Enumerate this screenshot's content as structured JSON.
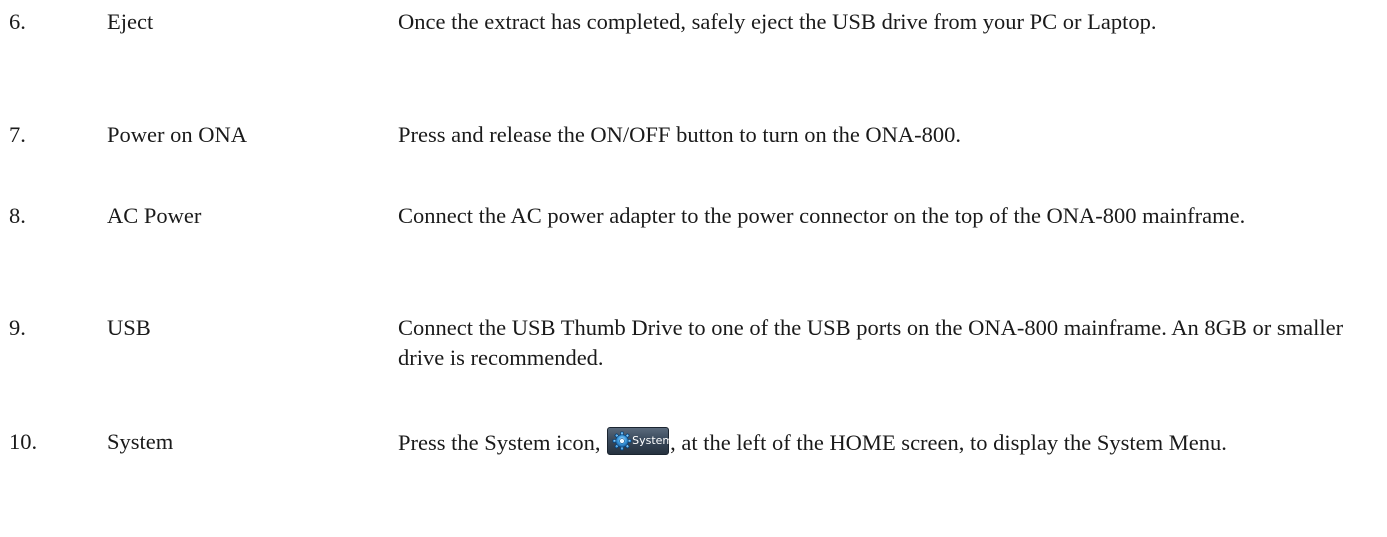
{
  "steps": [
    {
      "number": "6.",
      "title": "Eject",
      "description": "Once the extract has completed, safely eject the USB drive from your PC or Laptop."
    },
    {
      "number": "7.",
      "title": "Power on ONA",
      "description": "Press and release the ON/OFF button to turn on the ONA-800."
    },
    {
      "number": "8.",
      "title": "AC Power",
      "description": "Connect the AC power adapter to the power connector on the top of the ONA-800 mainframe."
    },
    {
      "number": "9.",
      "title": "USB",
      "description": "Connect the USB Thumb Drive to one of the USB ports on the ONA-800 mainframe.  An 8GB or smaller drive is recommended."
    },
    {
      "number": "10.",
      "title": "System",
      "description_before_icon": "Press the System icon, ",
      "description_after_icon": ", at the left of the HOME screen, to display the System Menu.",
      "icon": {
        "name": "gear-icon",
        "label": "System"
      }
    }
  ]
}
